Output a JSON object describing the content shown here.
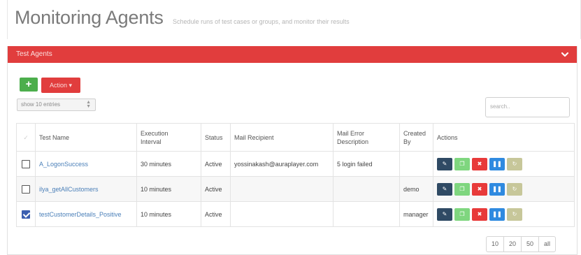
{
  "header": {
    "title": "Monitoring Agents",
    "subtitle": "Schedule runs of test cases or groups, and monitor their results"
  },
  "panel": {
    "title": "Test Agents"
  },
  "toolbar": {
    "add_label": "+",
    "action_label": "Action ▾"
  },
  "entries_select": {
    "value": "show 10 entries"
  },
  "search": {
    "placeholder": "search.."
  },
  "table": {
    "columns": {
      "name": "Test Name",
      "interval_1": "Execution",
      "interval_2": "Interval",
      "status": "Status",
      "mail": "Mail Recipient",
      "error_1": "Mail Error",
      "error_2": "Description",
      "created_1": "Created",
      "created_2": "By",
      "actions": "Actions"
    },
    "rows": [
      {
        "checked": false,
        "name": "A_LogonSuccess",
        "interval": "30 minutes",
        "status": "Active",
        "mail": "yossinakash@auraplayer.com",
        "error": "5 login failed",
        "created_by": ""
      },
      {
        "checked": false,
        "name": "ilya_getAllCustomers",
        "interval": "10 minutes",
        "status": "Active",
        "mail": "",
        "error": "",
        "created_by": "demo"
      },
      {
        "checked": true,
        "name": "testCustomerDetails_Positive",
        "interval": "10 minutes",
        "status": "Active",
        "mail": "",
        "error": "",
        "created_by": "manager"
      }
    ],
    "action_icons": [
      "edit-icon",
      "copy-icon",
      "delete-icon",
      "pause-icon",
      "refresh-icon"
    ]
  },
  "pagination": {
    "options": [
      "10",
      "20",
      "50",
      "all"
    ]
  },
  "colors": {
    "accent_red": "#e13d3d",
    "add_green": "#4cae4c",
    "link_blue": "#4a7fb8",
    "edit_navy": "#2f4a64",
    "copy_green": "#7fd67f",
    "delete_red": "#e83a3a",
    "pause_blue": "#2f8ae0",
    "run_khaki": "#c7c79a"
  }
}
